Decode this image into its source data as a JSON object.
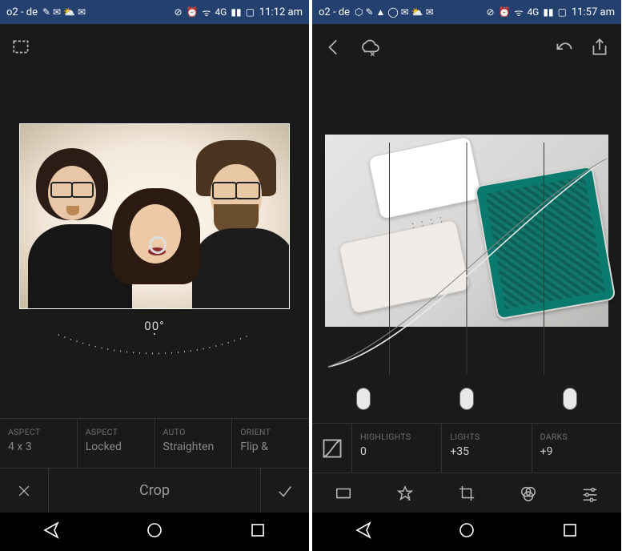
{
  "left": {
    "status": {
      "carrier": "o2 - de",
      "net": "4G",
      "time": "11:12 am"
    },
    "angle": "00°",
    "opts": [
      {
        "label": "ASPECT",
        "value": "4 x 3"
      },
      {
        "label": "ASPECT",
        "value": "Locked"
      },
      {
        "label": "AUTO",
        "value": "Straighten"
      },
      {
        "label": "ORIENT",
        "value": "Flip &"
      }
    ],
    "action": "Crop"
  },
  "right": {
    "status": {
      "carrier": "o2 - de",
      "net": "4G",
      "time": "11:57 am"
    },
    "opts": [
      {
        "label": "HIGHLIGHTS",
        "value": "0"
      },
      {
        "label": "LIGHTS",
        "value": "+35"
      },
      {
        "label": "DARKS",
        "value": "+9"
      }
    ]
  }
}
